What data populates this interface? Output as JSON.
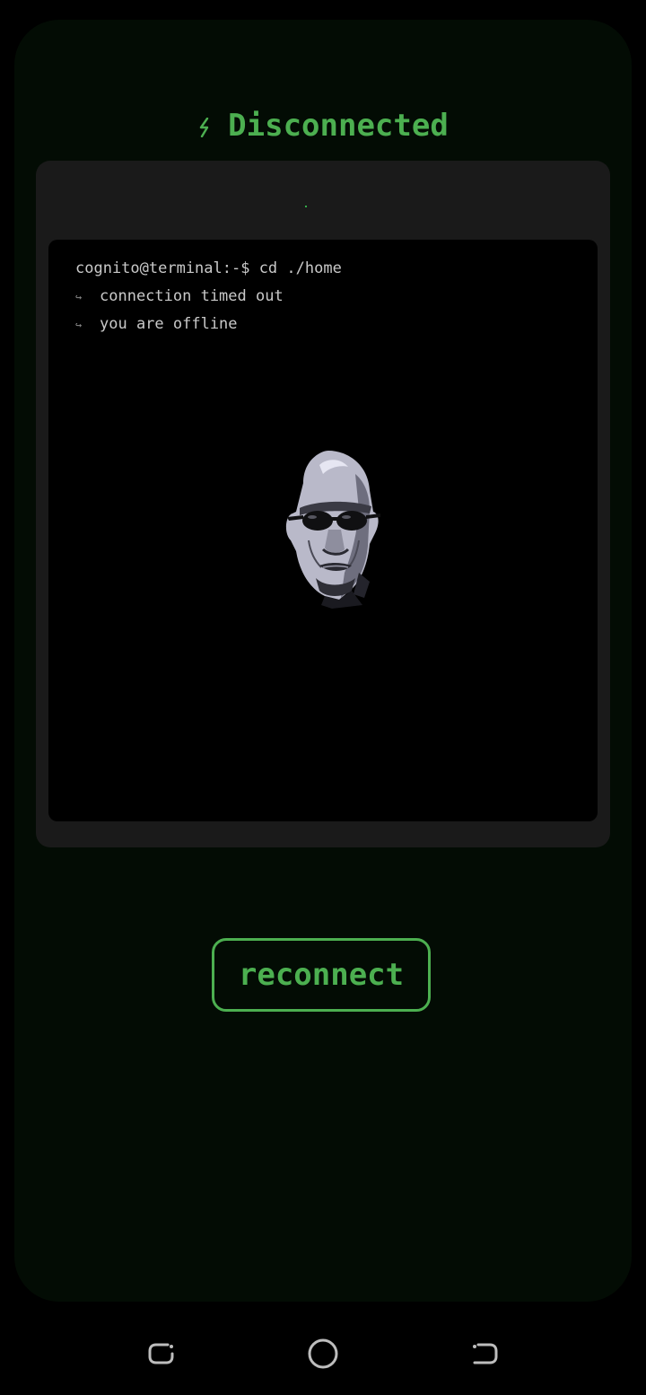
{
  "header": {
    "icon": "lightning-bolt-icon",
    "title": "Disconnected"
  },
  "terminal": {
    "prompt": "cognito@terminal:-$ cd ./home",
    "lines": [
      {
        "icon": "return-arrow-icon",
        "glyph": "↪",
        "text": "connection timed out"
      },
      {
        "icon": "return-arrow-icon",
        "glyph": "↪",
        "text": "you are offline"
      }
    ],
    "image": "man-with-sunglasses-portrait"
  },
  "actions": {
    "reconnect_label": "reconnect"
  },
  "navigation": {
    "items": [
      {
        "name": "recents",
        "icon": "recents-icon"
      },
      {
        "name": "home",
        "icon": "home-circle-icon"
      },
      {
        "name": "back",
        "icon": "back-icon"
      }
    ]
  },
  "colors": {
    "accent": "#4caf50",
    "panel_background": "#030c04",
    "terminal_card": "#1a1a1a",
    "terminal_screen": "#000000",
    "terminal_text": "#c9c9c9"
  }
}
